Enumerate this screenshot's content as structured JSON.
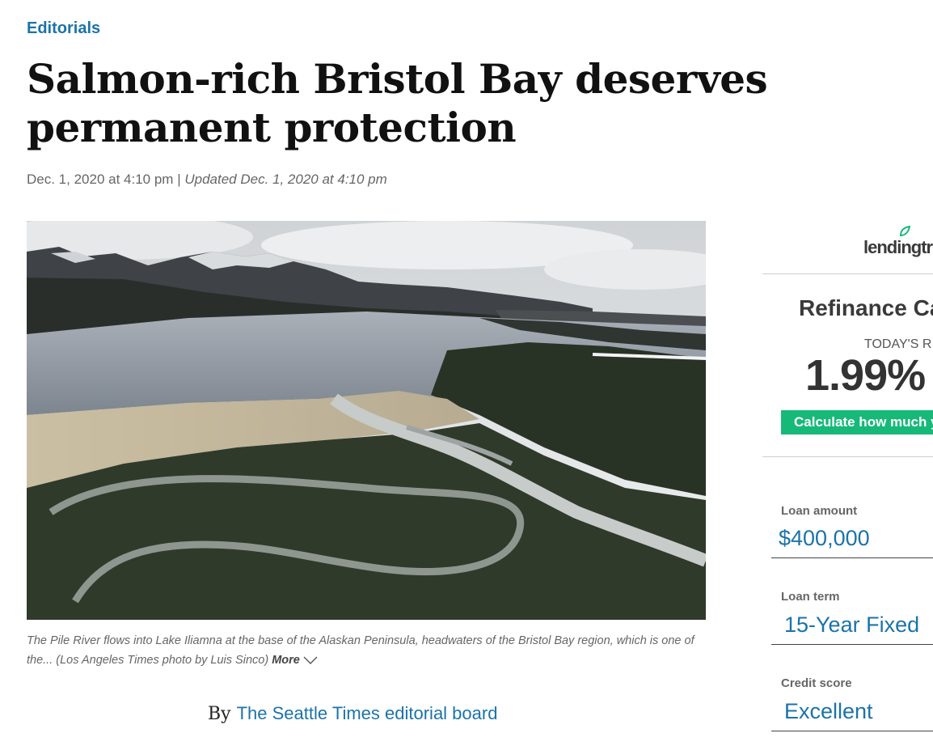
{
  "article": {
    "section": "Editorials",
    "headline": "Salmon-rich Bristol Bay deserves permanent protection",
    "date": "Dec. 1, 2020 at 4:10 pm",
    "separator": "|",
    "updated": "Updated Dec. 1, 2020 at 4:10 pm",
    "caption": "The Pile River flows into Lake Iliamna at the base of the Alaskan Peninsula, headwaters of the Bristol Bay region, which is one of the... (Los Angeles Times photo by Luis Sinco)",
    "caption_more": "More",
    "byline_prefix": "By",
    "author": "The Seattle Times editorial board"
  },
  "ad": {
    "logo": "lendingtr",
    "title": "Refinance Ca",
    "today_label": "TODAY'S R",
    "rate": "1.99% ",
    "cta": "Calculate how much y",
    "loan_amount_label": "Loan amount",
    "loan_amount_value": "$400,000",
    "loan_term_label": "Loan term",
    "loan_term_value": "15-Year Fixed",
    "credit_score_label": "Credit score",
    "credit_score_value": "Excellent",
    "accent": "#17b978"
  },
  "colors": {
    "link": "#1b73a9",
    "headline": "#111111",
    "meta": "#666666"
  }
}
